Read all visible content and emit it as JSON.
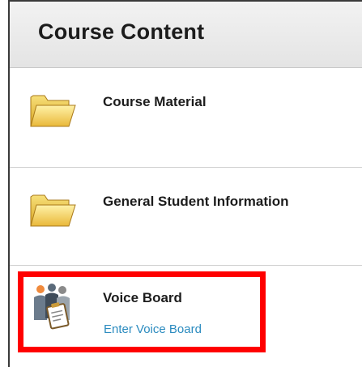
{
  "header": {
    "title": "Course Content"
  },
  "items": [
    {
      "icon": "folder-icon",
      "title": "Course Material"
    },
    {
      "icon": "folder-icon",
      "title": "General Student Information"
    },
    {
      "icon": "voice-board-icon",
      "title": "Voice Board",
      "link": "Enter Voice Board"
    }
  ],
  "colors": {
    "link": "#2b8bbf",
    "highlight": "#ff0000",
    "header_bg": "#e8e8e8"
  }
}
